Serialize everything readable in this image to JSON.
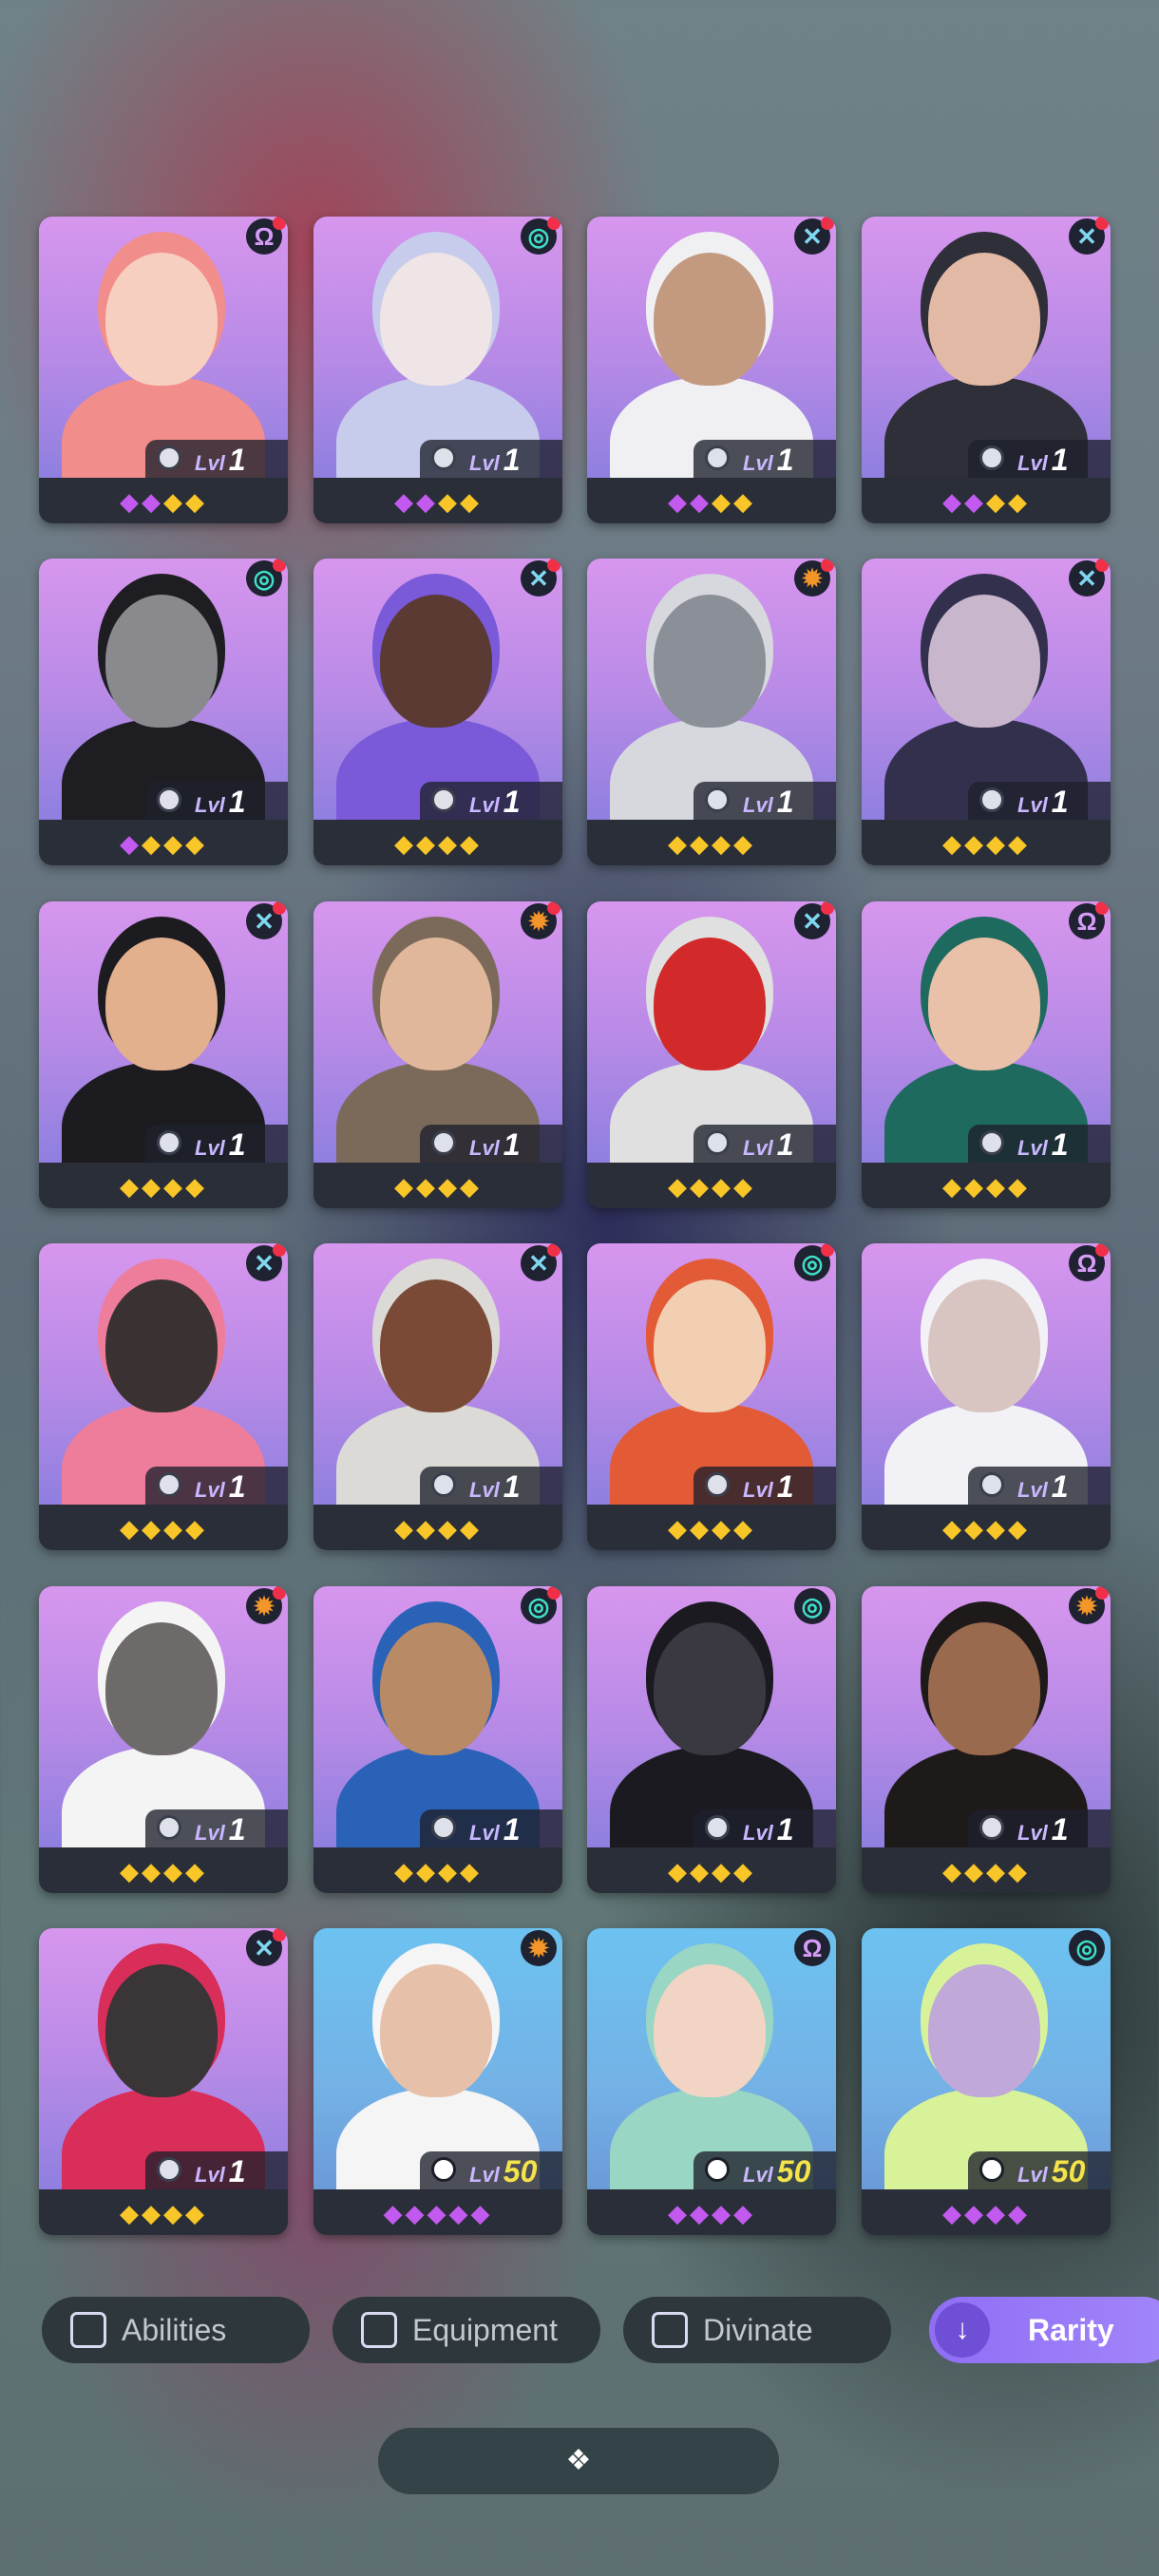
{
  "colors": {
    "portrait_default": "#c08ae9",
    "portrait_blue": "#72b6e8",
    "star_purple": "#c25af0",
    "star_gold": "#f8c628",
    "notification_dot": "#f03048",
    "rarity_button": "#9b7bf8"
  },
  "heroes": [
    {
      "class_icon": "omega-icon",
      "icon_color": "#d69cf8",
      "badge": true,
      "level_label": "Lvl",
      "level": "1",
      "stars": "ppyy",
      "bg": "default",
      "hair": "#f18d8a",
      "skin": "#f7cfc0"
    },
    {
      "class_icon": "swirl-icon",
      "icon_color": "#3ee0c8",
      "badge": true,
      "level_label": "Lvl",
      "level": "1",
      "stars": "ppyy",
      "bg": "default",
      "hair": "#c8ccec",
      "skin": "#efe4e6"
    },
    {
      "class_icon": "cross-icon",
      "icon_color": "#7fd8f0",
      "badge": true,
      "level_label": "Lvl",
      "level": "1",
      "stars": "ppyy",
      "bg": "default",
      "hair": "#f0f0f2",
      "skin": "#c39a80"
    },
    {
      "class_icon": "cross-icon",
      "icon_color": "#7fd8f0",
      "badge": true,
      "level_label": "Lvl",
      "level": "1",
      "stars": "ppyy",
      "bg": "default",
      "hair": "#2e2f38",
      "skin": "#e2b9a4"
    },
    {
      "class_icon": "swirl-icon",
      "icon_color": "#3ee0c8",
      "badge": true,
      "level_label": "Lvl",
      "level": "1",
      "stars": "pyyy",
      "bg": "default",
      "hair": "#1d1d22",
      "skin": "#8a8a8e"
    },
    {
      "class_icon": "cross-icon",
      "icon_color": "#7fd8f0",
      "badge": true,
      "level_label": "Lvl",
      "level": "1",
      "stars": "yyyy",
      "bg": "default",
      "hair": "#7a5ad8",
      "skin": "#5a3a32"
    },
    {
      "class_icon": "gear-icon",
      "icon_color": "#f2962a",
      "badge": true,
      "level_label": "Lvl",
      "level": "1",
      "stars": "yyyy",
      "bg": "default",
      "hair": "#d6d8de",
      "skin": "#8a8f98"
    },
    {
      "class_icon": "cross-icon",
      "icon_color": "#7fd8f0",
      "badge": true,
      "level_label": "Lvl",
      "level": "1",
      "stars": "yyyy",
      "bg": "default",
      "hair": "#33304e",
      "skin": "#c8b6cc"
    },
    {
      "class_icon": "cross-icon",
      "icon_color": "#7fd8f0",
      "badge": true,
      "level_label": "Lvl",
      "level": "1",
      "stars": "yyyy",
      "bg": "default",
      "hair": "#1b1b20",
      "skin": "#e3b08e"
    },
    {
      "class_icon": "gear-icon",
      "icon_color": "#f2962a",
      "badge": true,
      "level_label": "Lvl",
      "level": "1",
      "stars": "yyyy",
      "bg": "default",
      "hair": "#7b6a5a",
      "skin": "#e0b79a"
    },
    {
      "class_icon": "cross-icon",
      "icon_color": "#7fd8f0",
      "badge": true,
      "level_label": "Lvl",
      "level": "1",
      "stars": "yyyy",
      "bg": "default",
      "hair": "#e0e0e0",
      "skin": "#d22a2a"
    },
    {
      "class_icon": "omega-icon",
      "icon_color": "#d69cf8",
      "badge": true,
      "level_label": "Lvl",
      "level": "1",
      "stars": "yyyy",
      "bg": "default",
      "hair": "#1f6a5e",
      "skin": "#e9c0a8"
    },
    {
      "class_icon": "cross-icon",
      "icon_color": "#7fd8f0",
      "badge": true,
      "level_label": "Lvl",
      "level": "1",
      "stars": "yyyy",
      "bg": "default",
      "hair": "#ee7d9c",
      "skin": "#3a3232"
    },
    {
      "class_icon": "cross-icon",
      "icon_color": "#7fd8f0",
      "badge": true,
      "level_label": "Lvl",
      "level": "1",
      "stars": "yyyy",
      "bg": "default",
      "hair": "#dcdad6",
      "skin": "#7a4a36"
    },
    {
      "class_icon": "swirl-icon",
      "icon_color": "#3ee0c8",
      "badge": true,
      "level_label": "Lvl",
      "level": "1",
      "stars": "yyyy",
      "bg": "default",
      "hair": "#e25a36",
      "skin": "#f2cfb2"
    },
    {
      "class_icon": "omega-icon",
      "icon_color": "#d69cf8",
      "badge": true,
      "level_label": "Lvl",
      "level": "1",
      "stars": "yyyy",
      "bg": "default",
      "hair": "#f2f2f6",
      "skin": "#d8c4c0"
    },
    {
      "class_icon": "gear-icon",
      "icon_color": "#f2962a",
      "badge": true,
      "level_label": "Lvl",
      "level": "1",
      "stars": "yyyy",
      "bg": "default",
      "hair": "#f4f4f4",
      "skin": "#6e6a6a"
    },
    {
      "class_icon": "swirl-icon",
      "icon_color": "#3ee0c8",
      "badge": true,
      "level_label": "Lvl",
      "level": "1",
      "stars": "yyyy",
      "bg": "default",
      "hair": "#2a62b8",
      "skin": "#b98a66"
    },
    {
      "class_icon": "swirl-icon",
      "icon_color": "#3ee0c8",
      "badge": false,
      "level_label": "Lvl",
      "level": "1",
      "stars": "yyyy",
      "bg": "default",
      "hair": "#1a1a20",
      "skin": "#3a3840"
    },
    {
      "class_icon": "gear-icon",
      "icon_color": "#f2962a",
      "badge": true,
      "level_label": "Lvl",
      "level": "1",
      "stars": "yyyy",
      "bg": "default",
      "hair": "#1f1a1a",
      "skin": "#9a6a4e"
    },
    {
      "class_icon": "cross-icon",
      "icon_color": "#7fd8f0",
      "badge": true,
      "level_label": "Lvl",
      "level": "1",
      "stars": "yyyy",
      "bg": "default",
      "hair": "#d92d5a",
      "skin": "#3a3536"
    },
    {
      "class_icon": "gear-icon",
      "icon_color": "#f2962a",
      "badge": false,
      "level_label": "Lvl",
      "level": "50",
      "stars": "ppppp",
      "bg": "blue",
      "hair": "#f5f5f5",
      "skin": "#e6c0a8"
    },
    {
      "class_icon": "omega-icon",
      "icon_color": "#d69cf8",
      "badge": false,
      "level_label": "Lvl",
      "level": "50",
      "stars": "pppp",
      "bg": "blue",
      "hair": "#9ad6c4",
      "skin": "#f2d4c4"
    },
    {
      "class_icon": "swirl-icon",
      "icon_color": "#3ee0c8",
      "badge": false,
      "level_label": "Lvl",
      "level": "50",
      "stars": "pppp",
      "bg": "blue",
      "hair": "#d8f29a",
      "skin": "#c0a8d8"
    }
  ],
  "filters": {
    "abilities": "Abilities",
    "equipment": "Equipment",
    "divinate": "Divinate",
    "rarity": "Rarity"
  }
}
